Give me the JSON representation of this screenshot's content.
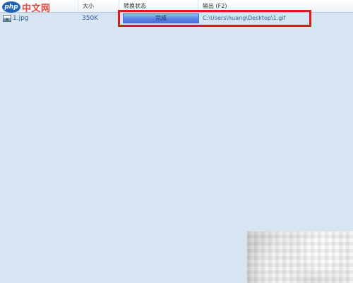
{
  "logo": {
    "badge": "php",
    "text": "中文网"
  },
  "columns": {
    "size": "大小",
    "status": "转换状态",
    "output": "输出 (F2)"
  },
  "file": {
    "icon": "image-file-icon",
    "name": "1.jpg",
    "size": "350K",
    "status": "完成",
    "progress": 1.0,
    "output_path": "C:\\Users\\huang\\Desktop\\1.gif"
  },
  "colors": {
    "highlight": "#e01818",
    "progress": "#5b83e6",
    "background": "#d7e5f3"
  }
}
